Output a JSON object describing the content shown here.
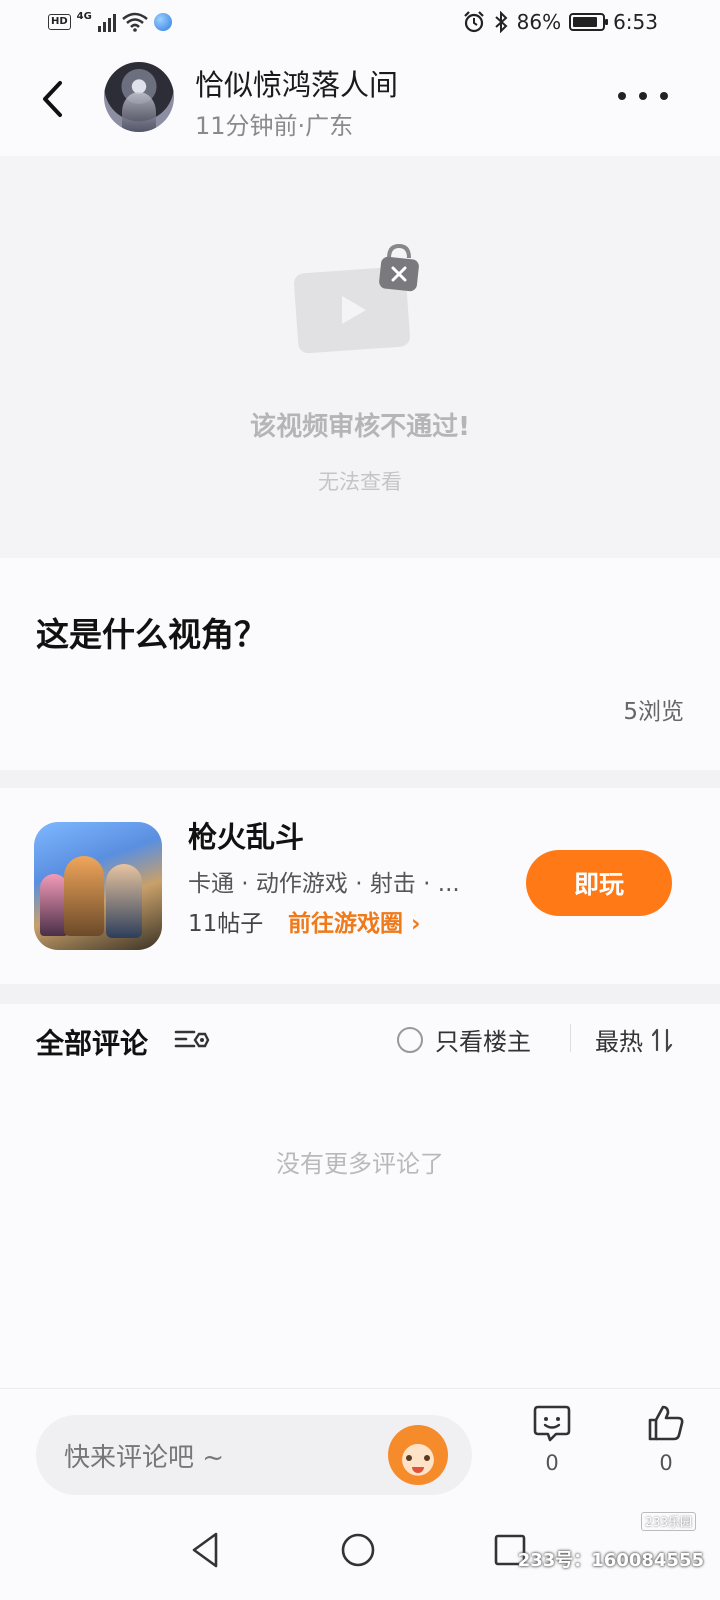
{
  "status_bar": {
    "hd": "HD",
    "network": "4G",
    "battery": "86%",
    "battery_level": 0.86,
    "time": "6:53"
  },
  "header": {
    "user_name": "恰似惊鸿落人间",
    "meta": "11分钟前·广东"
  },
  "video": {
    "blocked_title": "该视频审核不通过!",
    "blocked_sub": "无法查看"
  },
  "post": {
    "title": "这是什么视角？",
    "views": "5浏览"
  },
  "game": {
    "name": "枪火乱斗",
    "tags": "卡通 · 动作游戏 · 射击 · ...",
    "posts": "11帖子",
    "link": "前往游戏圈 ›",
    "play_label": "即玩",
    "accent": "#ff7a17"
  },
  "comments": {
    "title": "全部评论",
    "only_owner": "只看楼主",
    "sort": "最热",
    "empty": "没有更多评论了"
  },
  "bottom": {
    "input_placeholder": "快来评论吧 ~",
    "comment_count": "0",
    "like_count": "0"
  },
  "watermark": {
    "logo": "233乐园",
    "text": "233号：160084555"
  }
}
